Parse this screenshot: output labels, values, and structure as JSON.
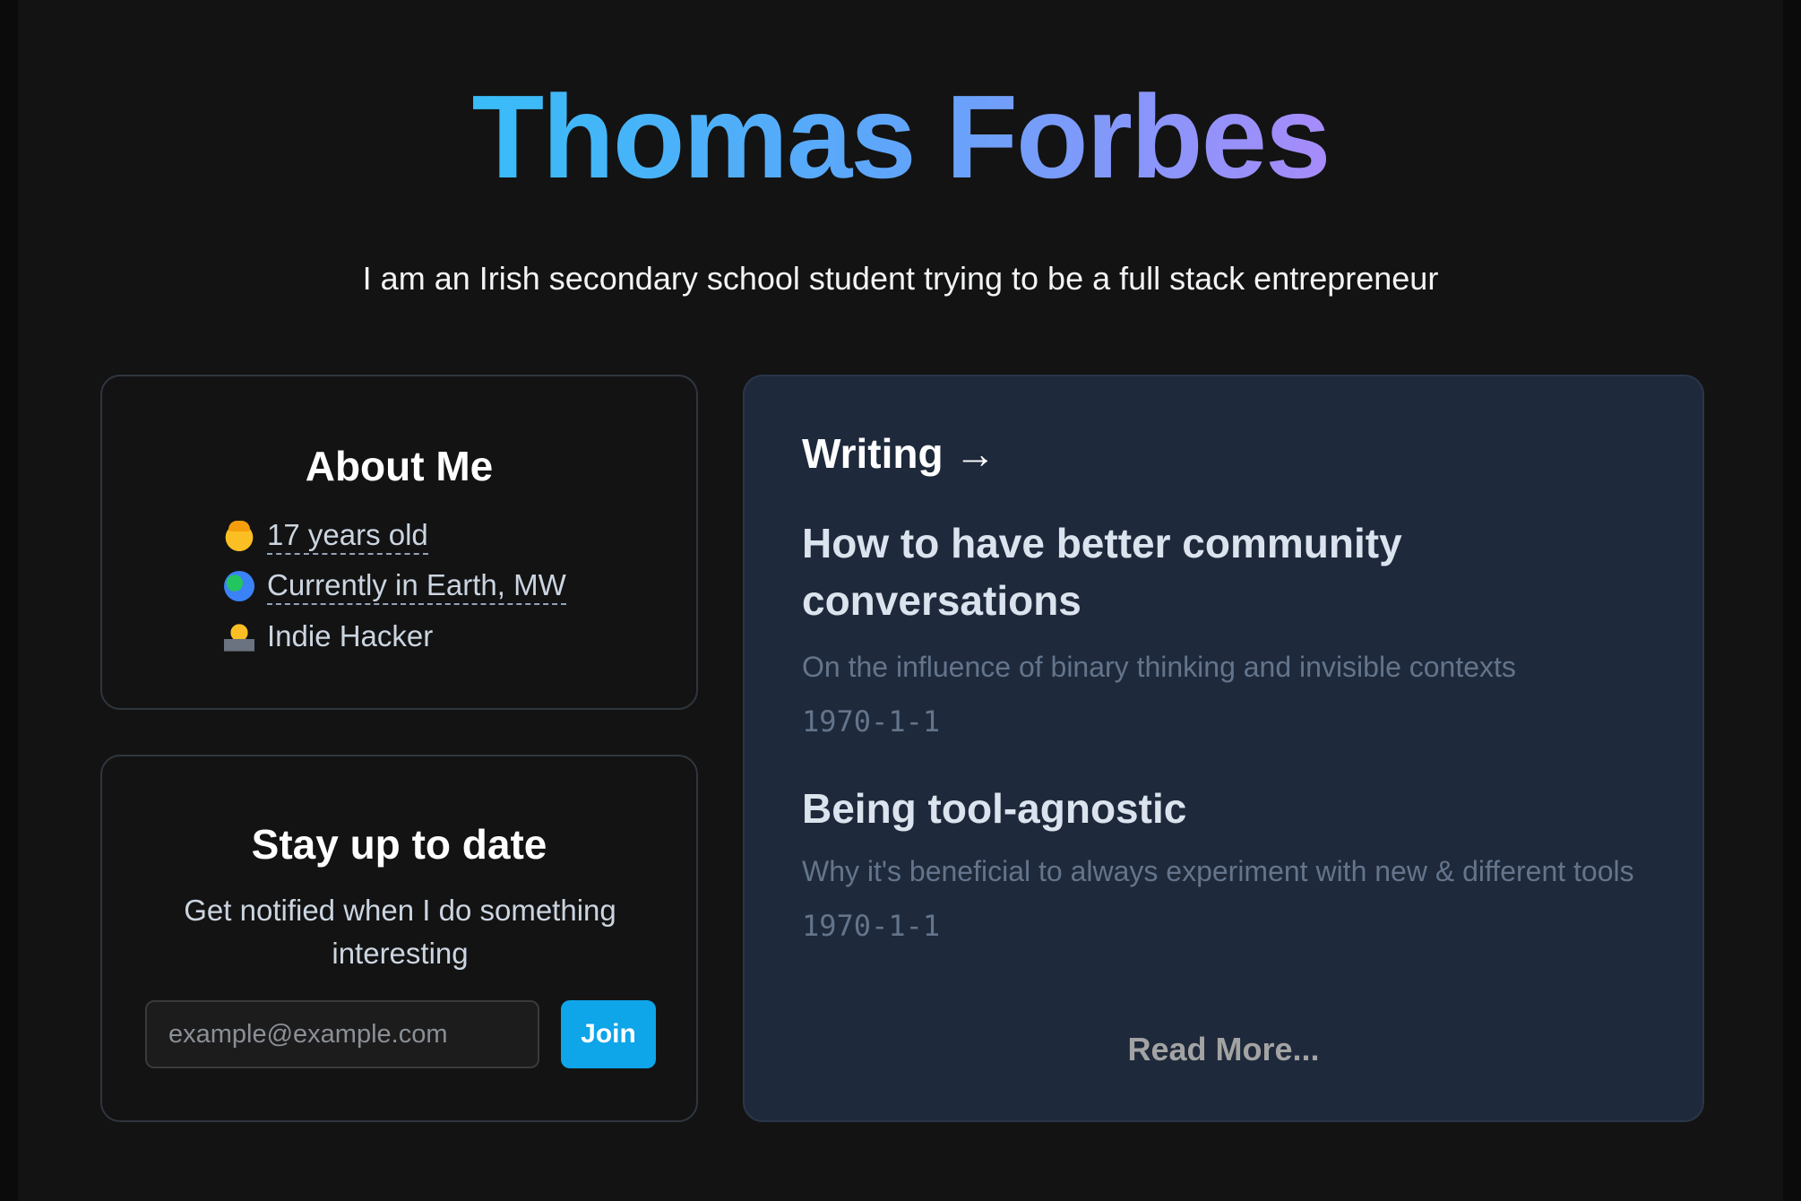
{
  "header": {
    "name": "Thomas Forbes",
    "tagline": "I am an Irish secondary school student trying to be a full stack entrepreneur"
  },
  "about": {
    "title": "About Me",
    "items": [
      {
        "emoji": "person-face-icon",
        "text": "17 years old"
      },
      {
        "emoji": "globe-icon",
        "text": "Currently in Earth, MW"
      },
      {
        "emoji": "technologist-icon",
        "text": "Indie Hacker"
      }
    ]
  },
  "newsletter": {
    "title": "Stay up to date",
    "subtitle": "Get notified when I do something interesting",
    "email_placeholder": "example@example.com",
    "join_label": "Join"
  },
  "writing": {
    "heading": "Writing →",
    "posts": [
      {
        "title": "How to have better community conversations",
        "description": "On the influence of binary thinking and invisible contexts",
        "date": "1970-1-1"
      },
      {
        "title": "Being tool-agnostic",
        "description": "Why it's beneficial to always experiment with new & different tools",
        "date": "1970-1-1"
      }
    ],
    "read_more": "Read More..."
  },
  "colors": {
    "background": "#131313",
    "card_border": "#30363f",
    "writing_card_bg": "#1e293b",
    "accent_button": "#0ea5e9",
    "title_gradient_start": "#38bdf8",
    "title_gradient_end": "#a78bfa"
  }
}
